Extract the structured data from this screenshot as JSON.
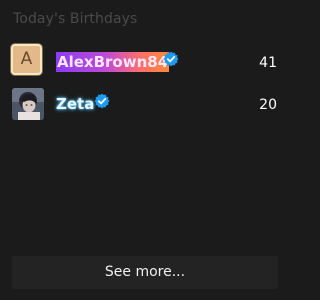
{
  "panel": {
    "heading": "Today's Birthdays"
  },
  "birthdays": [
    {
      "avatar_letter": "A",
      "name": "AlexBrown84",
      "verified": true,
      "age": "41"
    },
    {
      "avatar_photo": "user-photo",
      "name": "Zeta",
      "verified": true,
      "age": "20"
    }
  ],
  "footer": {
    "see_more_label": "See more..."
  },
  "colors": {
    "background": "#1b1b1b",
    "heading": "#4a4a4a",
    "verified_badge": "#1d9bf0",
    "button": "#232323"
  },
  "icons": {
    "verified": "verified-badge-icon"
  }
}
